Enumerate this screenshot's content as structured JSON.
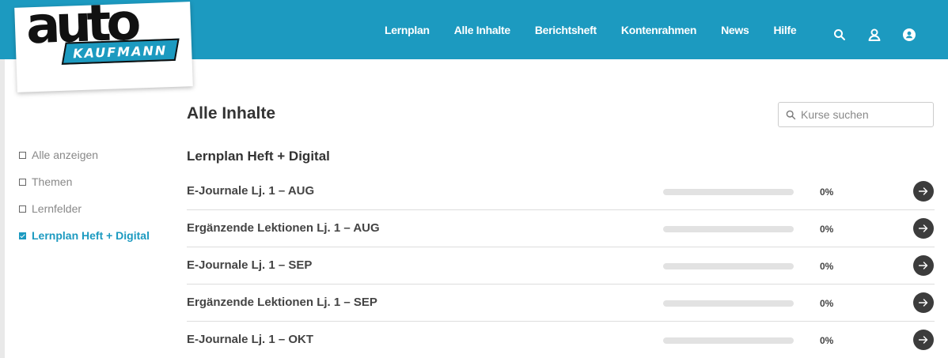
{
  "brand": {
    "word": "auto",
    "band": "KAUFMANN",
    "accent": "#1c9ac0"
  },
  "nav": [
    {
      "label": "Lernplan"
    },
    {
      "label": "Alle Inhalte"
    },
    {
      "label": "Berichtsheft"
    },
    {
      "label": "Kontenrahmen"
    },
    {
      "label": "News"
    },
    {
      "label": "Hilfe"
    }
  ],
  "header_icons": [
    "search-icon",
    "user-icon",
    "account-circle-icon"
  ],
  "sidebar": {
    "filters": [
      {
        "label": "Alle anzeigen",
        "checked": false
      },
      {
        "label": "Themen",
        "checked": false
      },
      {
        "label": "Lernfelder",
        "checked": false
      },
      {
        "label": "Lernplan Heft + Digital",
        "checked": true
      }
    ]
  },
  "main": {
    "title": "Alle Inhalte",
    "search": {
      "placeholder": "Kurse suchen"
    },
    "section_title": "Lernplan Heft + Digital",
    "rows": [
      {
        "title": "E-Journale Lj. 1 – AUG",
        "progress": 0,
        "progress_label": "0%"
      },
      {
        "title": "Ergänzende Lektionen Lj. 1 – AUG",
        "progress": 0,
        "progress_label": "0%"
      },
      {
        "title": "E-Journale Lj. 1 – SEP",
        "progress": 0,
        "progress_label": "0%"
      },
      {
        "title": "Ergänzende Lektionen Lj. 1 – SEP",
        "progress": 0,
        "progress_label": "0%"
      },
      {
        "title": "E-Journale Lj. 1 – OKT",
        "progress": 0,
        "progress_label": "0%"
      }
    ]
  }
}
